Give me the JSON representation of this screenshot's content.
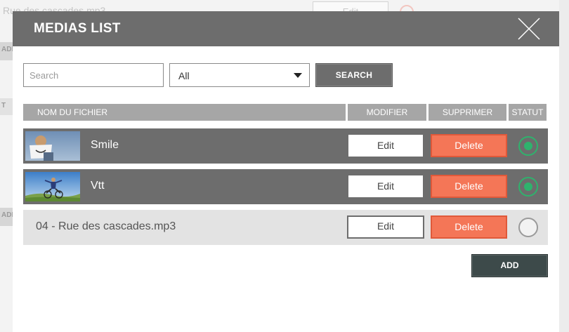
{
  "background": {
    "title_fragment": "Rue des cascades.mp3",
    "edit_label": "Edit",
    "side_labels": [
      "ADD",
      "T",
      "ADD"
    ]
  },
  "modal": {
    "title": "MEDIAS LIST",
    "close_icon": "close-x-icon"
  },
  "filters": {
    "search_placeholder": "Search",
    "search_value": "",
    "type_select_value": "All",
    "search_button": "SEARCH"
  },
  "table": {
    "headers": {
      "name": "NOM DU FICHIER",
      "modify": "MODIFIER",
      "delete": "SUPPRIMER",
      "status": "STATUT"
    },
    "rows": [
      {
        "name": "Smile",
        "edit_label": "Edit",
        "delete_label": "Delete",
        "status": "active",
        "thumbnail": "photo-smile-sign"
      },
      {
        "name": "Vtt",
        "edit_label": "Edit",
        "delete_label": "Delete",
        "status": "active",
        "thumbnail": "photo-bike-jump"
      },
      {
        "name": "04 - Rue des cascades.mp3",
        "edit_label": "Edit",
        "delete_label": "Delete",
        "status": "inactive",
        "thumbnail": ""
      }
    ]
  },
  "add_button": "ADD",
  "colors": {
    "header": "#6d6d6d",
    "delete": "#f47657",
    "status_active": "#2fb26d",
    "add_button": "#3d4a4a"
  }
}
